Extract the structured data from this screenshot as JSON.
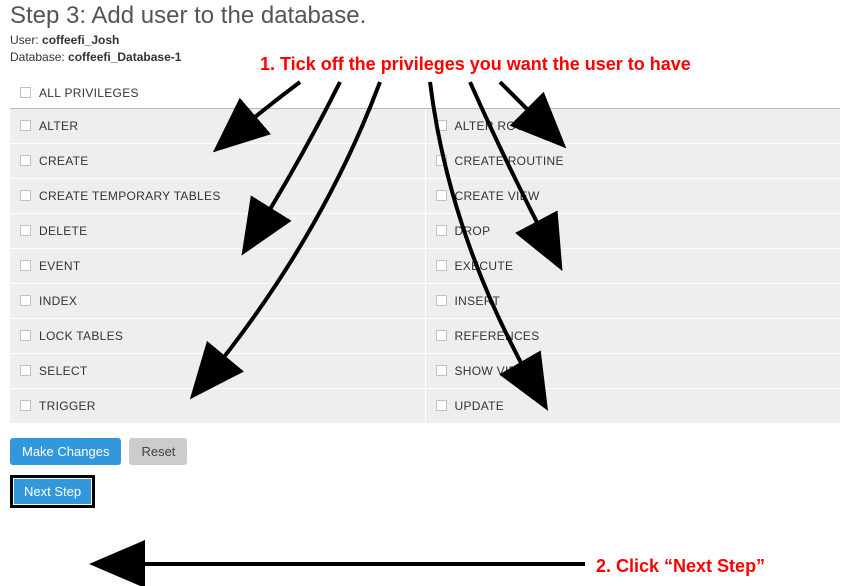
{
  "step_title": "Step 3: Add user to the database.",
  "user_label": "User:",
  "user_value": "coffeefi_Josh",
  "db_label": "Database:",
  "db_value": "coffeefi_Database-1",
  "all_privileges": "ALL PRIVILEGES",
  "privileges": {
    "left": [
      "ALTER",
      "CREATE",
      "CREATE TEMPORARY TABLES",
      "DELETE",
      "EVENT",
      "INDEX",
      "LOCK TABLES",
      "SELECT",
      "TRIGGER"
    ],
    "right": [
      "ALTER ROUTINE",
      "CREATE ROUTINE",
      "CREATE VIEW",
      "DROP",
      "EXECUTE",
      "INSERT",
      "REFERENCES",
      "SHOW VIEW",
      "UPDATE"
    ]
  },
  "buttons": {
    "make_changes": "Make Changes",
    "reset": "Reset",
    "next_step": "Next Step"
  },
  "annotations": {
    "tick_off": "1. Tick off the privileges you want the user to have",
    "click_next": "2. Click “Next Step”"
  }
}
